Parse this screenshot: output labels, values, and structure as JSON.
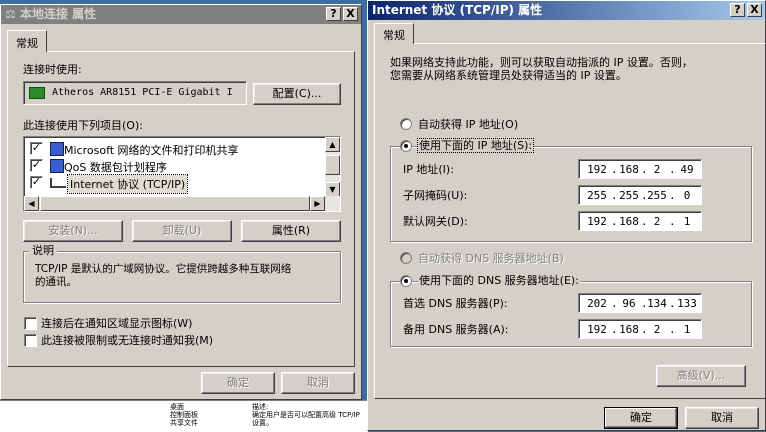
{
  "left_dialog": {
    "title": "本地连接 属性",
    "help_btn": "?",
    "close_btn": "X",
    "tab_general": "常规",
    "connect_using_label": "连接时使用:",
    "adapter_name": "Atheros AR8151 PCI-E Gigabit I",
    "configure_btn": "配置(C)...",
    "items_label": "此连接使用下列项目(O):",
    "items": [
      {
        "label": "Microsoft 网络的文件和打印机共享",
        "checked": true
      },
      {
        "label": "QoS 数据包计划程序",
        "checked": true
      },
      {
        "label": "Internet 协议 (TCP/IP)",
        "checked": true
      }
    ],
    "install_btn": "安装(N)...",
    "uninstall_btn": "卸载(U)",
    "properties_btn": "属性(R)",
    "description_title": "说明",
    "description_text_1": "TCP/IP 是默认的广域网协议。它提供跨越多种互联网络",
    "description_text_2": "的通讯。",
    "show_icon_label": "连接后在通知区域显示图标(W)",
    "notify_label": "此连接被限制或无连接时通知我(M)",
    "ok_btn": "确定",
    "cancel_btn": "取消"
  },
  "right_dialog": {
    "title": "Internet 协议 (TCP/IP) 属性",
    "help_btn": "?",
    "close_btn": "X",
    "tab_general": "常规",
    "intro_1": "如果网络支持此功能，则可以获取自动指派的 IP 设置。否则，",
    "intro_2": "您需要从网络系统管理员处获得适当的 IP 设置。",
    "auto_ip_label": "自动获得 IP 地址(O)",
    "manual_ip_label": "使用下面的 IP 地址(S):",
    "ip_label": "IP 地址(I):",
    "ip_value": [
      "192",
      "168",
      "2",
      "49"
    ],
    "mask_label": "子网掩码(U):",
    "mask_value": [
      "255",
      "255",
      "255",
      "0"
    ],
    "gateway_label": "默认网关(D):",
    "gateway_value": [
      "192",
      "168",
      "2",
      "1"
    ],
    "auto_dns_label": "自动获得 DNS 服务器地址(B)",
    "manual_dns_label": "使用下面的 DNS 服务器地址(E):",
    "dns1_label": "首选 DNS 服务器(P):",
    "dns1_value": [
      "202",
      "96",
      "134",
      "133"
    ],
    "dns2_label": "备用 DNS 服务器(A):",
    "dns2_value": [
      "192",
      "168",
      "2",
      "1"
    ],
    "advanced_btn": "高级(V)...",
    "ok_btn": "确定",
    "cancel_btn": "取消"
  },
  "background_window": {
    "tree_items": [
      "桌面",
      "控制面板",
      "共享文件"
    ],
    "hint_1": "描述:",
    "hint_2": "确定用户是否可以配置高级 TCP/IP",
    "hint_3": "设置。"
  },
  "colors": {
    "dialog_face": "#d4d0c8",
    "active_title_start": "#0a246a",
    "active_title_end": "#a6caf0",
    "inactive_title": "#808080"
  }
}
